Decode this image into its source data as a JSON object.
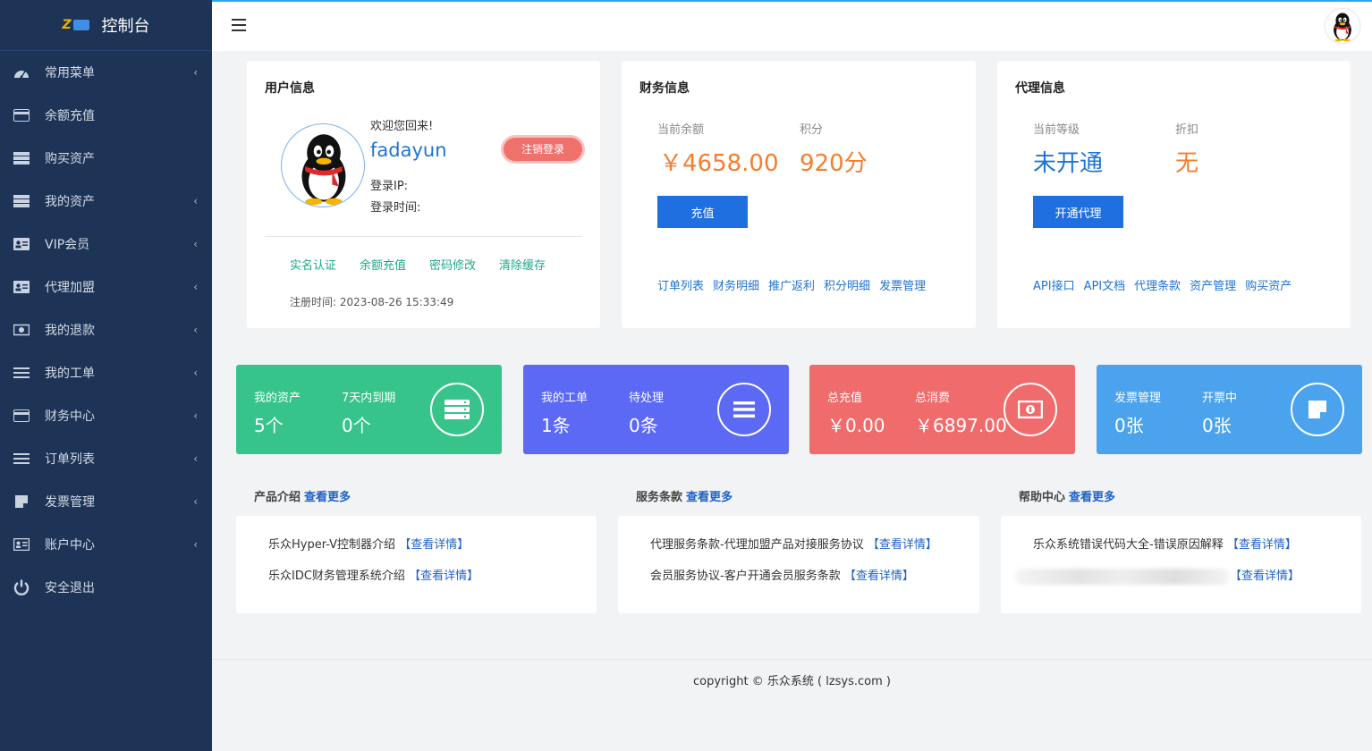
{
  "brand": {
    "title": "控制台",
    "logo_icon": "lezhong-logo"
  },
  "sidebar": {
    "items": [
      {
        "label": "常用菜单",
        "icon": "dashboard-icon",
        "has_children": true
      },
      {
        "label": "余额充值",
        "icon": "card-icon",
        "has_children": false
      },
      {
        "label": "购买资产",
        "icon": "server-icon",
        "has_children": false
      },
      {
        "label": "我的资产",
        "icon": "server-icon",
        "has_children": true
      },
      {
        "label": "VIP会员",
        "icon": "id-card-icon",
        "has_children": true
      },
      {
        "label": "代理加盟",
        "icon": "id-card-icon",
        "has_children": true
      },
      {
        "label": "我的退款",
        "icon": "money-icon",
        "has_children": true
      },
      {
        "label": "我的工单",
        "icon": "list-icon",
        "has_children": true
      },
      {
        "label": "财务中心",
        "icon": "card-icon",
        "has_children": true
      },
      {
        "label": "订单列表",
        "icon": "list-icon",
        "has_children": true
      },
      {
        "label": "发票管理",
        "icon": "note-icon",
        "has_children": true
      },
      {
        "label": "账户中心",
        "icon": "id-card-icon",
        "has_children": true
      },
      {
        "label": "安全退出",
        "icon": "power-icon",
        "has_children": false
      }
    ]
  },
  "user": {
    "title": "用户信息",
    "welcome": "欢迎您回来!",
    "username": "fadayun",
    "logout_label": "注销登录",
    "login_ip": "登录IP:",
    "login_time": "登录时间:",
    "links": [
      "实名认证",
      "余额充值",
      "密码修改",
      "清除缓存"
    ],
    "register_time": "注册时间:   2023-08-26 15:33:49"
  },
  "finance": {
    "title": "财务信息",
    "balance_label": "当前余额",
    "balance_value": "￥4658.00",
    "points_label": "积分",
    "points_value": "920分",
    "recharge_label": "充值",
    "links": [
      "订单列表",
      "财务明细",
      "推广返利",
      "积分明细",
      "发票管理"
    ]
  },
  "agent": {
    "title": "代理信息",
    "level_label": "当前等级",
    "level_value": "未开通",
    "discount_label": "折扣",
    "discount_value": "无",
    "open_label": "开通代理",
    "links": [
      "API接口",
      "API文档",
      "代理条款",
      "资产管理",
      "购买资产"
    ]
  },
  "stats": [
    {
      "label1": "我的资产",
      "value1": "5个",
      "label2": "7天内到期",
      "value2": "0个",
      "color": "#36c48b",
      "icon": "server-icon"
    },
    {
      "label1": "我的工单",
      "value1": "1条",
      "label2": "待处理",
      "value2": "0条",
      "color": "#5b69f5",
      "icon": "list-icon"
    },
    {
      "label1": "总充值",
      "value1": "￥0.00",
      "label2": "总消费",
      "value2": "￥6897.00",
      "color": "#f06b6b",
      "icon": "money-icon"
    },
    {
      "label1": "发票管理",
      "value1": "0张",
      "label2": "开票中",
      "value2": "0张",
      "color": "#4aa3ec",
      "icon": "note-icon"
    }
  ],
  "panels": [
    {
      "title": "产品介绍",
      "more": "查看更多",
      "rows": [
        {
          "text": "乐众Hyper-V控制器介绍",
          "detail": "【查看详情】"
        },
        {
          "text": "乐众IDC财务管理系统介绍",
          "detail": "【查看详情】"
        }
      ]
    },
    {
      "title": "服务条款",
      "more": "查看更多",
      "rows": [
        {
          "text": "代理服务条款-代理加盟产品对接服务协议",
          "detail": "【查看详情】"
        },
        {
          "text": "会员服务协议-客户开通会员服务条款",
          "detail": "【查看详情】"
        }
      ]
    },
    {
      "title": "帮助中心",
      "more": "查看更多",
      "rows": [
        {
          "text": "乐众系统错误代码大全-错误原因解释",
          "detail": "【查看详情】"
        },
        {
          "text": "",
          "detail": "【查看详情】"
        }
      ]
    }
  ],
  "footer": "copyright © 乐众系统 ( lzsys.com )",
  "colors": {
    "sidebar": "#1d3457",
    "accent": "#1f6fe0",
    "orange": "#f47d2e",
    "blue": "#1f73d2"
  }
}
